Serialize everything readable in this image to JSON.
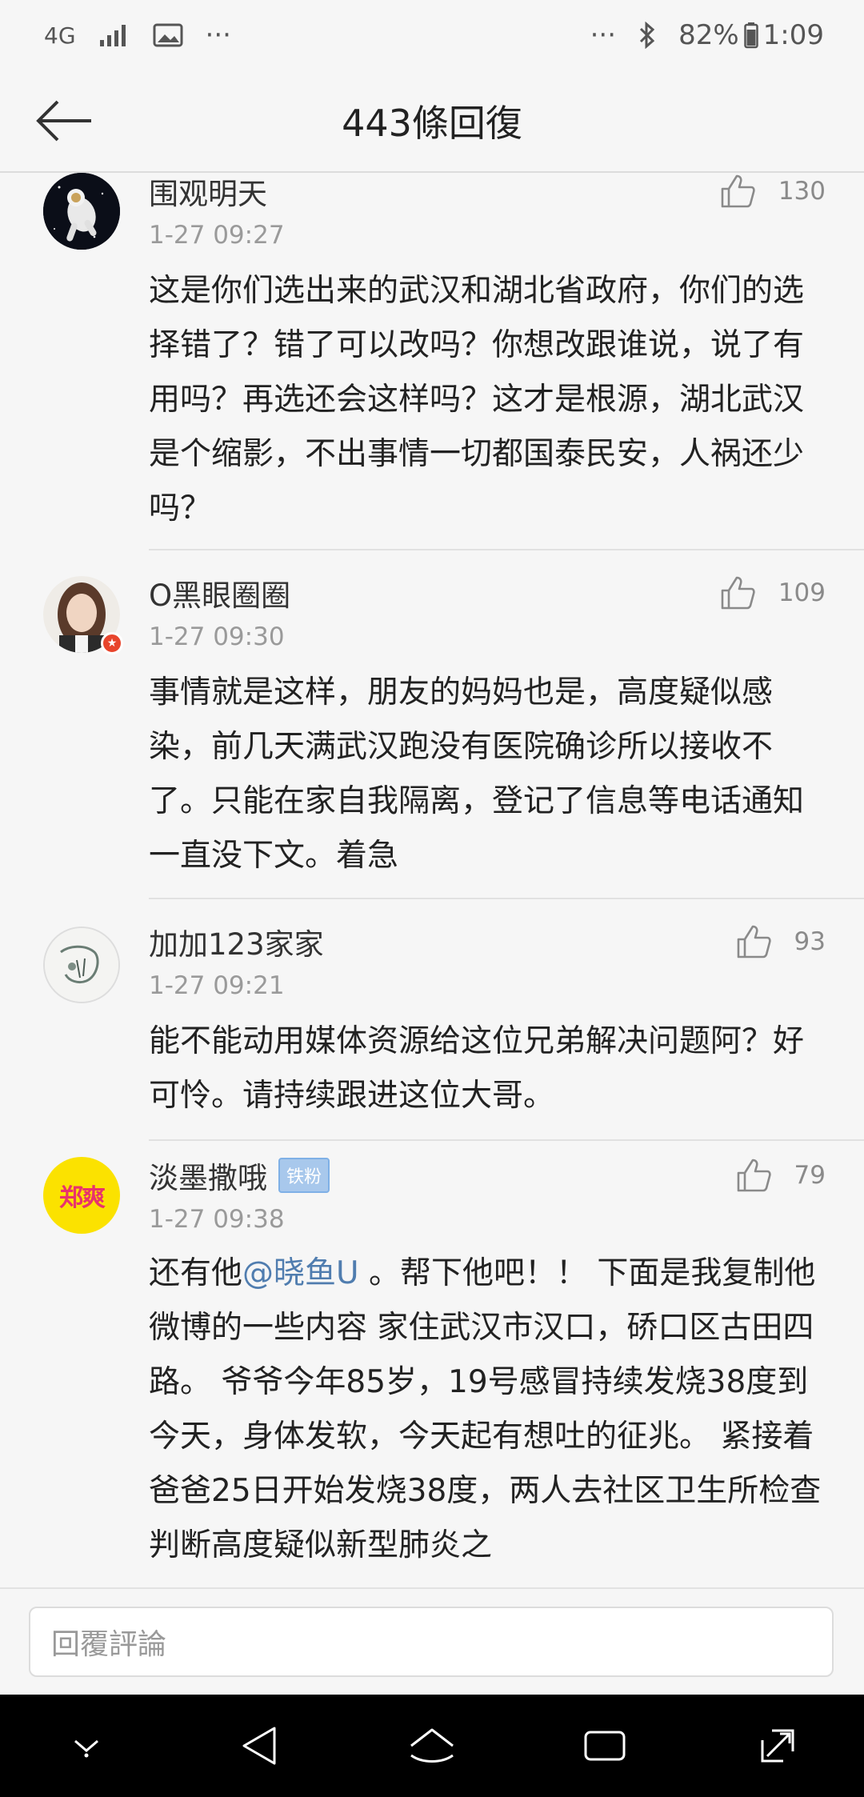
{
  "status_bar": {
    "network": "4G",
    "more_left": "···",
    "more_right": "···",
    "battery": "82%",
    "time": "1:09"
  },
  "header": {
    "title": "443條回復"
  },
  "comments": [
    {
      "username": "围观明天",
      "time": "1-27 09:27",
      "likes": "130",
      "text": "这是你们选出来的武汉和湖北省政府，你们的选择错了？错了可以改吗？你想改跟谁说，说了有用吗？再选还会这样吗？这才是根源，湖北武汉是个缩影，不出事情一切都国泰民安，人祸还少吗？"
    },
    {
      "username": "O黑眼圈圈",
      "time": "1-27 09:30",
      "likes": "109",
      "text": "事情就是这样，朋友的妈妈也是，高度疑似感染，前几天满武汉跑没有医院确诊所以接收不了。只能在家自我隔离，登记了信息等电话通知一直没下文。着急"
    },
    {
      "username": "加加123家家",
      "time": "1-27 09:21",
      "likes": "93",
      "text": "能不能动用媒体资源给这位兄弟解决问题阿？好可怜。请持续跟进这位大哥。"
    },
    {
      "username": "淡墨撒哦",
      "badge": "铁粉",
      "avatar_text": "郑爽",
      "time": "1-27 09:38",
      "likes": "79",
      "text_before": "还有他",
      "mention": "@晓鱼U",
      "text_after": " 。帮下他吧！！ 下面是我复制他微博的一些内容 家住武汉市汉口，硚口区古田四路。 爷爷今年85岁，19号感冒持续发烧38度到今天，身体发软，今天起有想吐的征兆。 紧接着爸爸25日开始发烧38度，两人去社区卫生所检查判断高度疑似新型肺炎之"
    }
  ],
  "reply_input": {
    "placeholder": "回覆評論"
  },
  "colors": {
    "background": "#f6f6f6",
    "mention": "#507daf",
    "meta_gray": "#9a9a9a",
    "nav_bar": "#000000"
  }
}
